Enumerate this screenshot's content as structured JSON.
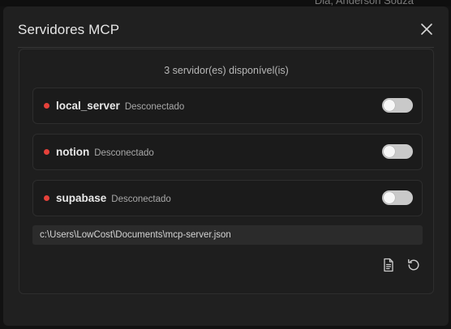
{
  "dialog": {
    "title": "Servidores MCP",
    "close_icon": "close-icon"
  },
  "backdrop": {
    "clipped_text": "Dia, Anderson Souza"
  },
  "servers_panel": {
    "count_text": "3 servidor(es) disponível(is)",
    "servers": [
      {
        "name": "local_server",
        "status": "Desconectado",
        "enabled": false
      },
      {
        "name": "notion",
        "status": "Desconectado",
        "enabled": false
      },
      {
        "name": "supabase",
        "status": "Desconectado",
        "enabled": false
      }
    ],
    "config_path": "c:\\Users\\LowCost\\Documents\\mcp-server.json"
  },
  "actions": {
    "open_file_icon": "file-icon",
    "reload_icon": "refresh-icon"
  },
  "colors": {
    "status_disconnected": "#e5413a",
    "toggle_off": "#c9c9c9",
    "dialog_bg": "#202020"
  }
}
